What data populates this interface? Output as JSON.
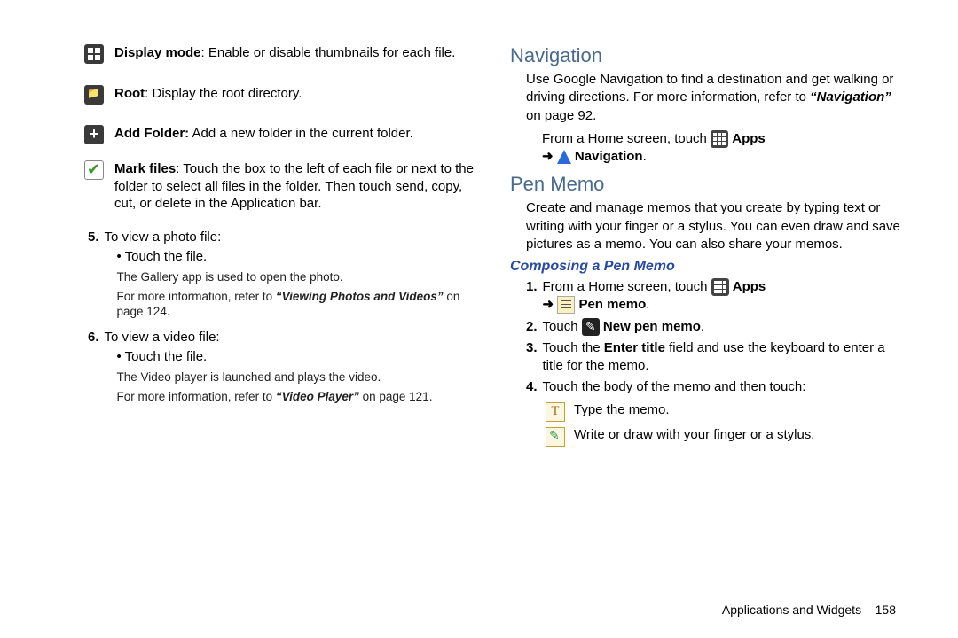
{
  "left": {
    "defs": [
      {
        "icon": "grid",
        "term": "Display mode",
        "text": ": Enable or disable thumbnails for each file."
      },
      {
        "icon": "root",
        "term": "Root",
        "text": ": Display the root directory."
      },
      {
        "icon": "plus",
        "term": "Add Folder:",
        "text": " Add a new folder in the current folder."
      },
      {
        "icon": "check",
        "term": "Mark files",
        "text": ": Touch the box to the left of each file or next to the folder to select all files in the folder. Then touch send, copy, cut, or delete in the Application bar."
      }
    ],
    "steps": [
      {
        "num": "5.",
        "lead": "To view a photo file:",
        "bullet": "Touch the file.",
        "note1": "The Gallery app is used to open the photo.",
        "note2_pre": "For more information, refer to ",
        "note2_link": "“Viewing Photos and Videos”",
        "note2_post": " on page 124."
      },
      {
        "num": "6.",
        "lead": "To view a video file:",
        "bullet": "Touch the file.",
        "note1": "The Video player is launched and plays the video.",
        "note2_pre": "For more information, refer to ",
        "note2_link": "“Video Player”",
        "note2_post": "  on page 121."
      }
    ]
  },
  "right": {
    "nav": {
      "heading": "Navigation",
      "para_pre": "Use Google Navigation to find a destination and get walking or driving directions. For more information, refer to ",
      "para_link": "“Navigation”",
      "para_post": "  on page 92.",
      "instr_pre": "From a Home screen, touch ",
      "apps_label": "Apps",
      "arrow": "➜",
      "nav_label": "Navigation",
      "dot": "."
    },
    "pen": {
      "heading": "Pen Memo",
      "para": "Create and manage memos that you create by typing text or writing with your finger or a stylus. You can even draw and save pictures as a memo. You can also share your memos.",
      "sub": "Composing a Pen Memo",
      "s1_pre": "From a Home screen, touch ",
      "apps_label": "Apps",
      "arrow": "➜",
      "penmemo_label": "Pen memo",
      "dot": ".",
      "s2_pre": "Touch ",
      "newmemo_label": "New pen memo",
      "s3_a": "Touch the ",
      "s3_b": "Enter title",
      "s3_c": " field and use the keyboard to enter a title for the memo.",
      "s4": "Touch the body of the memo and then touch:",
      "opt_type": "Type the memo.",
      "opt_draw": "Write or draw with your finger or a stylus."
    }
  },
  "footer": {
    "section": "Applications and Widgets",
    "page": "158"
  }
}
